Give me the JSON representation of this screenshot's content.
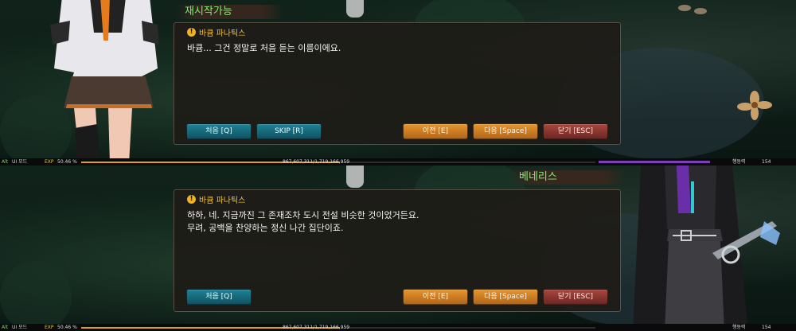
{
  "panels": [
    {
      "nameplate": "재시작가능",
      "speaker": "바큠 파나틱스",
      "lines": [
        "바큠... 그건 정말로 처음 듣는 이름이에요."
      ],
      "buttons_left": [
        {
          "label": "처음 [Q]",
          "style": "teal"
        },
        {
          "label": "SKIP [R]",
          "style": "teal"
        }
      ],
      "buttons_right": [
        {
          "label": "이전 [E]",
          "style": "orange"
        },
        {
          "label": "다음 [Space]",
          "style": "orange"
        },
        {
          "label": "닫기 [ESC]",
          "style": "red"
        }
      ],
      "status": {
        "tag": "Alt",
        "mode": "UI 모드",
        "exp_label": "EXP",
        "exp_percent": "50.46 %",
        "exp_fill": 0.5046,
        "exp_value": "867,607,311/1,719,166,959",
        "stamina_label": "행동력",
        "stamina_value": "154"
      }
    },
    {
      "nameplate": "베네리스",
      "speaker": "바큠 파나틱스",
      "lines": [
        "하하, 네. 지금까진 그 존재조차 도시 전설 비슷한 것이었거든요.",
        "무려, 공백을 찬양하는 정신 나간 집단이죠."
      ],
      "buttons_left": [
        {
          "label": "처음 [Q]",
          "style": "teal"
        }
      ],
      "buttons_right": [
        {
          "label": "이전 [E]",
          "style": "orange"
        },
        {
          "label": "다음 [Space]",
          "style": "orange"
        },
        {
          "label": "닫기 [ESC]",
          "style": "red"
        }
      ],
      "status": {
        "tag": "Alt",
        "mode": "UI 모드",
        "exp_label": "EXP",
        "exp_percent": "50.46 %",
        "exp_fill": 0.5046,
        "exp_value": "867,607,311/1,719,166,959",
        "stamina_label": "행동력",
        "stamina_value": "154"
      }
    }
  ],
  "colors": {
    "speaker_name": "#f4c230",
    "nameplate_text": "#7ef06a",
    "exp_bar": "#d9a31d",
    "teal_button": "#1f8296",
    "orange_button": "#e6952e",
    "red_button": "#a9463e"
  },
  "icons": {
    "speaker_marker": "exclamation-circle-icon"
  }
}
